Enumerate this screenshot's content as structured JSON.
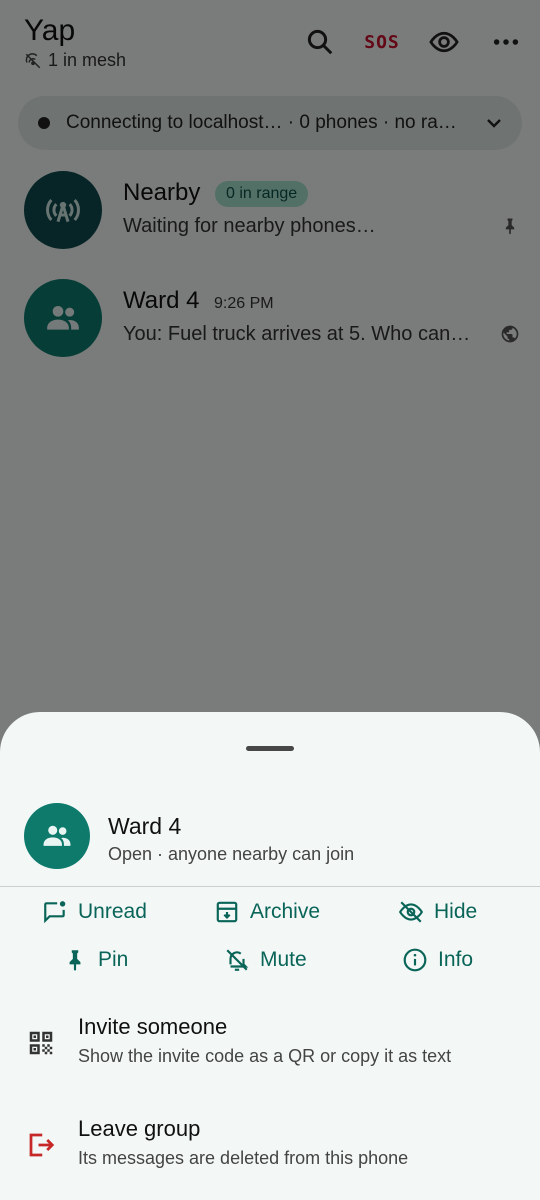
{
  "appbar": {
    "title": "Yap",
    "mesh_status": "1 in mesh",
    "sos_label": "SOS"
  },
  "connection": {
    "text": "Connecting to localhost… · 0 phones · no ra…"
  },
  "chats": [
    {
      "name": "Nearby",
      "badge": "0 in range",
      "subtitle": "Waiting for nearby phones…",
      "avatar_color": "#0e4b4c",
      "trail_icon": "pin-icon"
    },
    {
      "name": "Ward 4",
      "time": "9:26 PM",
      "subtitle": "You: Fuel truck arrives at 5. Who can…",
      "avatar_color": "#0d7a6c",
      "trail_icon": "globe-icon"
    }
  ],
  "sheet": {
    "title": "Ward 4",
    "subtitle": "Open · anyone nearby can join",
    "actions": [
      {
        "label": "Unread",
        "icon": "mark-unread-icon"
      },
      {
        "label": "Archive",
        "icon": "archive-icon"
      },
      {
        "label": "Hide",
        "icon": "eye-off-icon"
      },
      {
        "label": "Pin",
        "icon": "pin-icon"
      },
      {
        "label": "Mute",
        "icon": "bell-off-icon"
      },
      {
        "label": "Info",
        "icon": "info-icon"
      }
    ],
    "menu": [
      {
        "title": "Invite someone",
        "subtitle": "Show the invite code as a QR or copy it as text",
        "icon": "qr-code-icon"
      },
      {
        "title": "Leave group",
        "subtitle": "Its messages are deleted from this phone",
        "icon": "logout-icon"
      }
    ]
  },
  "colors": {
    "accent": "#0a6558",
    "sos": "#c8102e",
    "leave": "#c62828"
  }
}
